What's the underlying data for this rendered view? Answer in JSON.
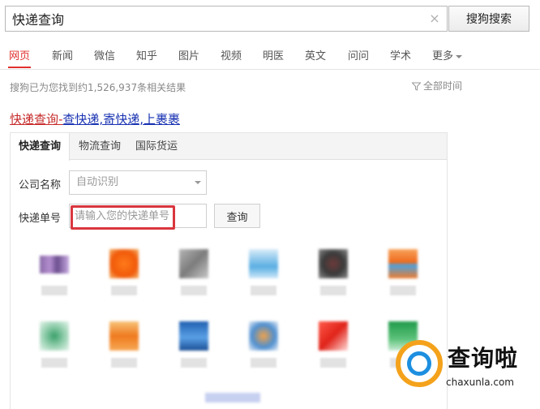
{
  "search": {
    "query": "快递查询",
    "button_label": "搜狗搜索",
    "clear_icon": "×"
  },
  "nav": {
    "tabs": [
      "网页",
      "新闻",
      "微信",
      "知乎",
      "图片",
      "视频",
      "明医",
      "英文",
      "问问",
      "学术",
      "更多"
    ],
    "active_tab": "网页"
  },
  "results": {
    "count_text": "搜狗已为您找到约1,526,937条相关结果",
    "time_filter_label": "全部时间"
  },
  "result_title": {
    "part1": "快递查询-",
    "part2": "查快递,寄快递,上裹裹"
  },
  "card": {
    "tabs": [
      "快递查询",
      "物流查询",
      "国际货运"
    ],
    "company_label": "公司名称",
    "company_value": "自动识别",
    "tracking_label": "快递单号",
    "tracking_placeholder": "请输入您的快递单号",
    "query_button": "查询"
  },
  "colors": {
    "accent_red": "#e0302e",
    "link_blue": "#1a33b2",
    "highlight_red": "#d9363e",
    "watermark_orange": "#f4a21b",
    "watermark_blue": "#1d8fe0"
  },
  "watermark": {
    "brand": "查询啦",
    "url": "chaxunla.com"
  }
}
